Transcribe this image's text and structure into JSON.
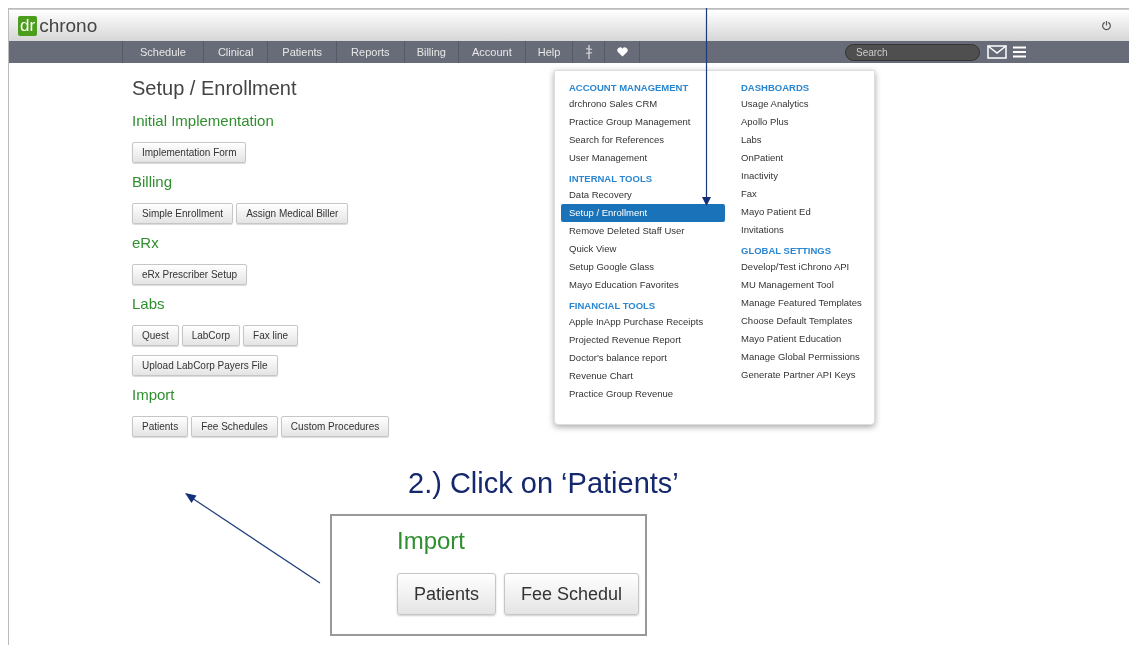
{
  "header": {
    "logo_mark": "dr",
    "logo_text": "chrono"
  },
  "nav": {
    "items": [
      "Schedule",
      "Clinical",
      "Patients",
      "Reports",
      "Billing",
      "Account",
      "Help"
    ],
    "search": {
      "placeholder": "Search"
    }
  },
  "dropdown": {
    "columns": [
      [
        {
          "heading": "ACCOUNT MANAGEMENT",
          "items": [
            {
              "label": "drchrono Sales CRM",
              "selected": false
            },
            {
              "label": "Practice Group Management",
              "selected": false
            },
            {
              "label": "Search for References",
              "selected": false
            },
            {
              "label": "User Management",
              "selected": false
            }
          ]
        },
        {
          "heading": "INTERNAL TOOLS",
          "items": [
            {
              "label": "Data Recovery",
              "selected": false
            },
            {
              "label": "Setup / Enrollment",
              "selected": true
            },
            {
              "label": "Remove Deleted Staff User",
              "selected": false
            },
            {
              "label": "Quick View",
              "selected": false
            },
            {
              "label": "Setup Google Glass",
              "selected": false
            },
            {
              "label": "Mayo Education Favorites",
              "selected": false
            }
          ]
        },
        {
          "heading": "FINANCIAL TOOLS",
          "items": [
            {
              "label": "Apple InApp Purchase Receipts",
              "selected": false
            },
            {
              "label": "Projected Revenue Report",
              "selected": false
            },
            {
              "label": "Doctor's balance report",
              "selected": false
            },
            {
              "label": "Revenue Chart",
              "selected": false
            },
            {
              "label": "Practice Group Revenue",
              "selected": false
            }
          ]
        }
      ],
      [
        {
          "heading": "DASHBOARDS",
          "items": [
            {
              "label": "Usage Analytics",
              "selected": false
            },
            {
              "label": "Apollo Plus",
              "selected": false
            },
            {
              "label": "Labs",
              "selected": false
            },
            {
              "label": "OnPatient",
              "selected": false
            },
            {
              "label": "Inactivity",
              "selected": false
            },
            {
              "label": "Fax",
              "selected": false
            },
            {
              "label": "Mayo Patient Ed",
              "selected": false
            },
            {
              "label": "Invitations",
              "selected": false
            }
          ]
        },
        {
          "heading": "GLOBAL SETTINGS",
          "items": [
            {
              "label": "Develop/Test iChrono API",
              "selected": false
            },
            {
              "label": "MU Management Tool",
              "selected": false
            },
            {
              "label": "Manage Featured Templates",
              "selected": false
            },
            {
              "label": "Choose Default Templates",
              "selected": false
            },
            {
              "label": "Mayo Patient Education",
              "selected": false
            },
            {
              "label": "Manage Global Permissions",
              "selected": false
            },
            {
              "label": "Generate Partner API Keys",
              "selected": false
            }
          ]
        }
      ]
    ]
  },
  "page": {
    "title": "Setup / Enrollment",
    "sections": [
      {
        "heading": "Initial Implementation",
        "button_rows": [
          [
            "Implementation Form"
          ]
        ]
      },
      {
        "heading": "Billing",
        "button_rows": [
          [
            "Simple Enrollment",
            "Assign Medical Biller"
          ]
        ]
      },
      {
        "heading": "eRx",
        "button_rows": [
          [
            "eRx Prescriber Setup"
          ]
        ]
      },
      {
        "heading": "Labs",
        "button_rows": [
          [
            "Quest",
            "LabCorp",
            "Fax line"
          ],
          [
            "Upload LabCorp Payers File"
          ]
        ]
      },
      {
        "heading": "Import",
        "button_rows": [
          [
            "Patients",
            "Fee Schedules",
            "Custom Procedures"
          ]
        ]
      }
    ]
  },
  "annotation": {
    "callout": "2.) Click on ‘Patients’",
    "inset": {
      "heading": "Import",
      "buttons": [
        "Patients",
        "Fee Schedul"
      ]
    }
  }
}
